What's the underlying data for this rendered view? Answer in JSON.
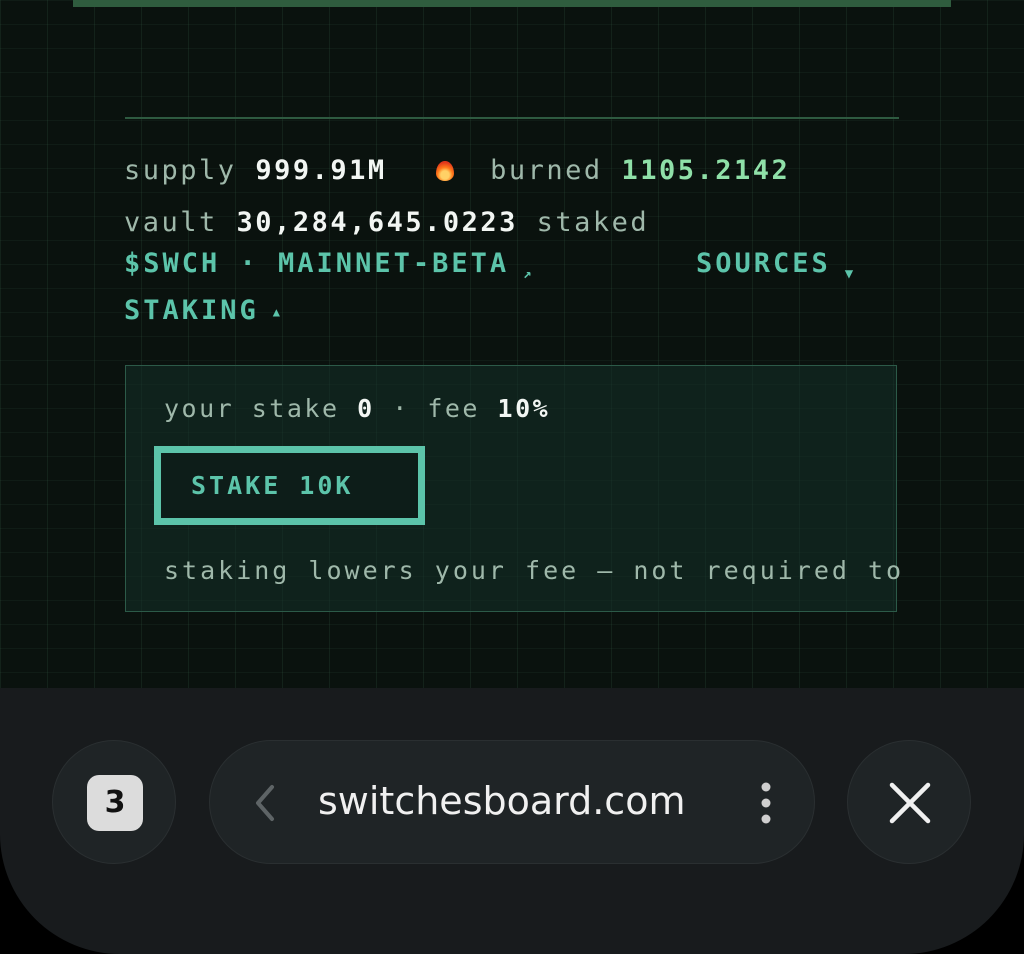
{
  "stats": {
    "supply_label": "supply",
    "supply_value": "999.91M",
    "burned_label": "burned",
    "burned_value": "1105.2142",
    "vault_label": "vault",
    "vault_value": "30,284,645.0223",
    "vault_suffix": "staked"
  },
  "links": {
    "network": "$SWCH · MAINNET-BETA",
    "network_arrow": "↗",
    "sources": "SOURCES",
    "sources_arrow": "▼",
    "staking": "STAKING",
    "staking_arrow": "▲"
  },
  "stake_panel": {
    "your_stake_label": "your stake",
    "your_stake_value": "0",
    "separator": "·",
    "fee_label": "fee",
    "fee_value": "10%",
    "button_label": "STAKE 10K",
    "note": "staking lowers your fee — not required to"
  },
  "browser": {
    "tab_count": "3",
    "url": "switchesboard.com"
  },
  "icons": {
    "burned": "flame-icon",
    "back": "chevron-left-icon",
    "more": "more-vertical-icon",
    "close": "close-icon"
  },
  "colors": {
    "background": "#0a120e",
    "accent": "#5cc4aa",
    "burned_value": "#8fe0a8",
    "text_bright": "#f2f6f3",
    "text_muted": "#9fb8aa",
    "browser_bar": "#181b1d"
  }
}
